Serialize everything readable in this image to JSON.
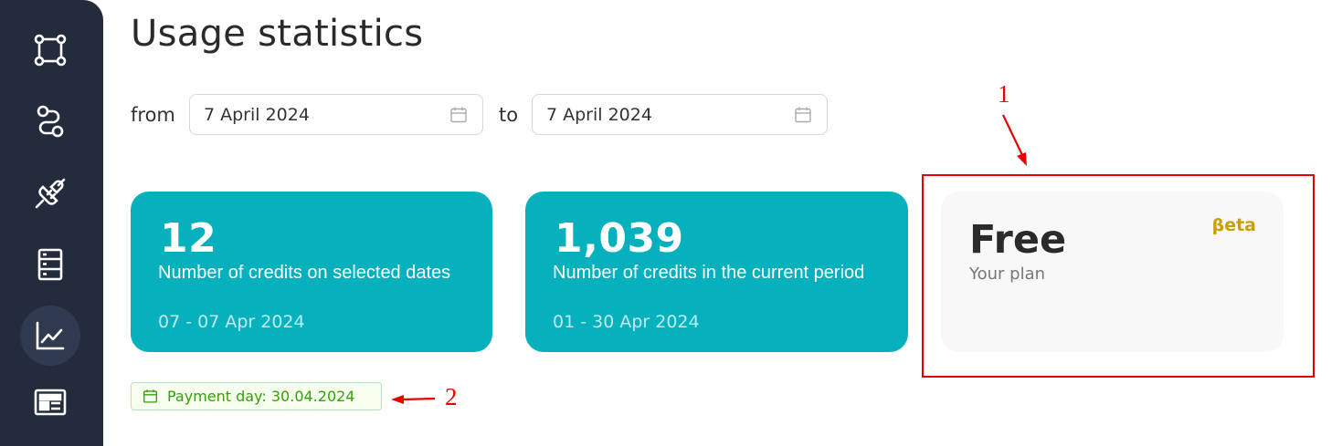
{
  "page": {
    "title": "Usage statistics"
  },
  "sidebar": {
    "items": [
      {
        "icon": "nodes-icon",
        "active": false
      },
      {
        "icon": "route-icon",
        "active": false
      },
      {
        "icon": "plug-icon",
        "active": false
      },
      {
        "icon": "server-icon",
        "active": false
      },
      {
        "icon": "chart-line-icon",
        "active": true
      },
      {
        "icon": "newspaper-icon",
        "active": false
      }
    ]
  },
  "filters": {
    "from_label": "from",
    "to_label": "to",
    "from_value": "7 April 2024",
    "to_value": "7 April 2024",
    "calendar_icon": "calendar-icon"
  },
  "cards": [
    {
      "value": "12",
      "description": "Number of credits on selected dates",
      "range": "07 - 07 Apr 2024"
    },
    {
      "value": "1,039",
      "description": "Number of credits in the current period",
      "range": "01 - 30 Apr 2024"
    }
  ],
  "plan": {
    "name": "Free",
    "subtitle": "Your plan",
    "badge": "βeta"
  },
  "payment": {
    "label": "Payment day: 30.04.2024",
    "icon": "calendar-icon"
  },
  "annotations": {
    "one": "1",
    "two": "2",
    "color": "#e60000"
  },
  "colors": {
    "sidebar": "#232b3d",
    "card_accent": "#06b0bd",
    "plan_card": "#f8f8f8",
    "beta": "#c9a000",
    "payment_text": "#389e0d"
  }
}
